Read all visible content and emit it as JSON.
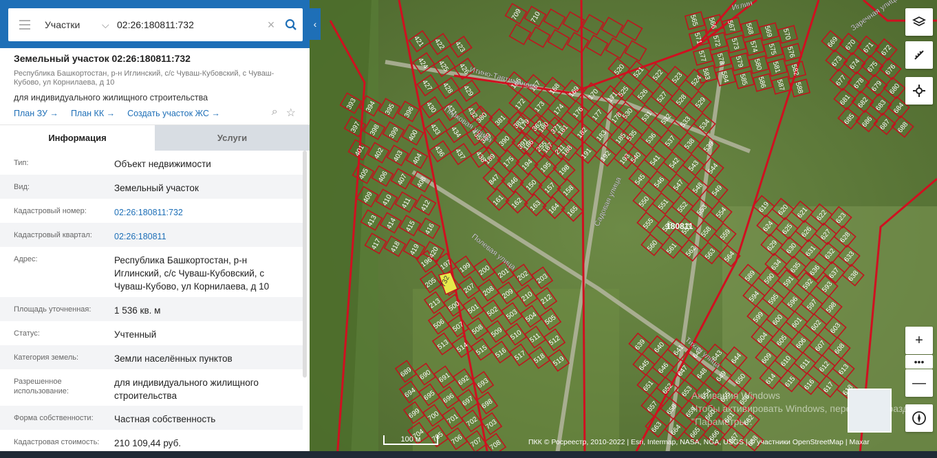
{
  "search": {
    "type": "Участки",
    "query": "02:26:180811:732"
  },
  "parcel": {
    "title": "Земельный участок 02:26:180811:732",
    "address": "Республика Башкортостан, р-н Иглинский, с/с Чуваш-Кубовский, с Чуваш-Кубово, ул Корнилаева, д 10",
    "purpose": "для индивидуального жилищного строительства",
    "links": [
      "План ЗУ →",
      "План КК →",
      "Создать участок ЖС →"
    ]
  },
  "tabs": [
    "Информация",
    "Услуги"
  ],
  "info_rows": [
    {
      "label": "Тип:",
      "value": "Объект недвижимости"
    },
    {
      "label": "Вид:",
      "value": "Земельный участок"
    },
    {
      "label": "Кадастровый номер:",
      "value": "02:26:180811:732"
    },
    {
      "label": "Кадастровый квартал:",
      "value": "02:26:180811"
    },
    {
      "label": "Адрес:",
      "value": "Республика Башкортостан, р-н Иглинский, с/с Чуваш-Кубовский, с Чуваш-Кубово, ул Корнилаева, д 10"
    },
    {
      "label": "Площадь уточненная:",
      "value": "1 536 кв. м"
    },
    {
      "label": "Статус:",
      "value": "Учтенный"
    },
    {
      "label": "Категория земель:",
      "value": "Земли населённых пунктов"
    },
    {
      "label": "Разрешенное использование:",
      "value": "для индивидуального жилищного строительства"
    },
    {
      "label": "Форма собственности:",
      "value": "Частная собственность"
    },
    {
      "label": "Кадастровая стоимость:",
      "value": "210 109,44 руб."
    }
  ],
  "map": {
    "streets": [
      "Итино-Тавтиманово",
      "Парковая улица",
      "Садовая улица",
      "Полевая улица",
      "Тихая улица",
      "Заречная улица",
      "Иглин"
    ],
    "quarter_label": "180811",
    "highlighted_parcel": "732",
    "parcel_labels": [
      "393",
      "394",
      "395",
      "396",
      "397",
      "398",
      "399",
      "400",
      "401",
      "402",
      "403",
      "404",
      "405",
      "406",
      "407",
      "408",
      "409",
      "410",
      "411",
      "412",
      "413",
      "414",
      "415",
      "416",
      "417",
      "418",
      "419",
      "420",
      "421",
      "422",
      "423",
      "424",
      "425",
      "426",
      "427",
      "428",
      "429",
      "430",
      "431",
      "432",
      "433",
      "434",
      "435",
      "436",
      "437",
      "438",
      "380",
      "381",
      "383",
      "362",
      "371",
      "389",
      "390",
      "391",
      "255",
      "211",
      "189",
      "175",
      "194",
      "195",
      "198",
      "847",
      "846",
      "150",
      "157",
      "158",
      "161",
      "162",
      "163",
      "164",
      "165",
      "166",
      "167",
      "168",
      "169",
      "170",
      "171",
      "172",
      "173",
      "174",
      "176",
      "177",
      "178",
      "179",
      "180",
      "181",
      "182",
      "183",
      "185",
      "186",
      "187",
      "188",
      "191",
      "192",
      "193",
      "196",
      "197",
      "199",
      "200",
      "201",
      "202",
      "203",
      "205",
      "206",
      "207",
      "208",
      "209",
      "210",
      "212",
      "213",
      "500",
      "501",
      "502",
      "503",
      "504",
      "505",
      "506",
      "507",
      "508",
      "509",
      "510",
      "511",
      "512",
      "513",
      "514",
      "515",
      "516",
      "517",
      "518",
      "519",
      "520",
      "521",
      "522",
      "523",
      "524",
      "525",
      "526",
      "527",
      "528",
      "529",
      "530",
      "531",
      "532",
      "533",
      "534",
      "535",
      "536",
      "537",
      "538",
      "539",
      "540",
      "541",
      "542",
      "543",
      "544",
      "545",
      "546",
      "547",
      "548",
      "549",
      "550",
      "551",
      "552",
      "553",
      "554",
      "555",
      "556",
      "557",
      "558",
      "559",
      "560",
      "561",
      "562",
      "563",
      "564",
      "565",
      "566",
      "567",
      "568",
      "569",
      "570",
      "571",
      "572",
      "573",
      "574",
      "575",
      "576",
      "577",
      "578",
      "579",
      "580",
      "581",
      "582",
      "583",
      "584",
      "585",
      "586",
      "587",
      "588",
      "589",
      "590",
      "591",
      "592",
      "593",
      "594",
      "595",
      "596",
      "597",
      "598",
      "599",
      "600",
      "601",
      "602",
      "603",
      "604",
      "605",
      "606",
      "607",
      "608",
      "609",
      "610",
      "611",
      "612",
      "613",
      "614",
      "615",
      "616",
      "617",
      "618",
      "619",
      "620",
      "621",
      "622",
      "623",
      "624",
      "625",
      "626",
      "627",
      "628",
      "629",
      "630",
      "631",
      "632",
      "633",
      "634",
      "635",
      "636",
      "637",
      "638",
      "639",
      "640",
      "641",
      "642",
      "643",
      "644",
      "645",
      "646",
      "647",
      "648",
      "649",
      "650",
      "651",
      "652",
      "653",
      "654",
      "655",
      "656",
      "657",
      "658",
      "659",
      "660",
      "661",
      "662",
      "663",
      "664",
      "665",
      "666",
      "667",
      "668",
      "669",
      "670",
      "671",
      "672",
      "673",
      "674",
      "675",
      "676",
      "677",
      "678",
      "679",
      "680",
      "681",
      "682",
      "683",
      "684",
      "685",
      "686",
      "687",
      "688",
      "689",
      "690",
      "691",
      "692",
      "693",
      "694",
      "695",
      "696",
      "697",
      "698",
      "699",
      "700",
      "701",
      "702",
      "703",
      "704",
      "705",
      "706",
      "707",
      "708",
      "709",
      "710"
    ],
    "scale_label": "100 м",
    "attribution": "ПКК © Росреестр, 2010-2022 | Esri, Intermap, NASA, NGA, USGS | © участники OpenStreetMap | Maxar",
    "watermark": "Активация Windows\nЧтобы активировать Windows, перейдите в раздел \"Параметры\"."
  },
  "map_controls": [
    "layers-icon",
    "ruler-icon",
    "crosshair-icon",
    "zoom-in-icon",
    "more-icon",
    "zoom-out-icon",
    "compass-icon"
  ],
  "colors": {
    "header_blue": "#1e6fb7",
    "parcel_outline": "#c0141e",
    "highlight": "#e6e84a",
    "link": "#1e6fb7"
  }
}
